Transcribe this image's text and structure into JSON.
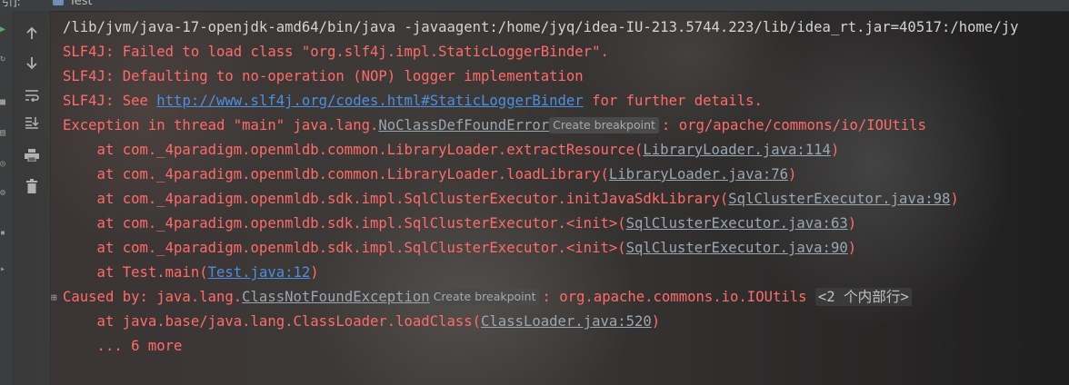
{
  "topbar": {
    "clipped_label": "引]:",
    "tab_label": "Test"
  },
  "toolbar": {
    "up": "↑",
    "down": "↓",
    "wrap": "⤶",
    "scroll_end": "⇊",
    "print": "🖶",
    "trash": "🗑"
  },
  "console": {
    "cmd": "/lib/jvm/java-17-openjdk-amd64/bin/java -javaagent:/home/jyq/idea-IU-213.5744.223/lib/idea_rt.jar=40517:/home/jy",
    "slf1": "SLF4J: Failed to load class \"org.slf4j.impl.StaticLoggerBinder\".",
    "slf2": "SLF4J: Defaulting to no-operation (NOP) logger implementation",
    "slf3_pre": "SLF4J: See ",
    "slf3_url": "http://www.slf4j.org/codes.html#StaticLoggerBinder",
    "slf3_post": " for further details.",
    "exc_pre": "Exception in thread \"main\" java.lang.",
    "exc_class": "NoClassDefFoundError",
    "exc_hint": "Create breakpoint",
    "exc_post": ": org/apache/commons/io/IOUtils",
    "frames": [
      {
        "pre": "    at com._4paradigm.openmldb.common.LibraryLoader.extractResource(",
        "link": "LibraryLoader.java:114",
        "post": ")"
      },
      {
        "pre": "    at com._4paradigm.openmldb.common.LibraryLoader.loadLibrary(",
        "link": "LibraryLoader.java:76",
        "post": ")"
      },
      {
        "pre": "    at com._4paradigm.openmldb.sdk.impl.SqlClusterExecutor.initJavaSdkLibrary(",
        "link": "SqlClusterExecutor.java:98",
        "post": ")"
      },
      {
        "pre": "    at com._4paradigm.openmldb.sdk.impl.SqlClusterExecutor.<init>(",
        "link": "SqlClusterExecutor.java:63",
        "post": ")"
      },
      {
        "pre": "    at com._4paradigm.openmldb.sdk.impl.SqlClusterExecutor.<init>(",
        "link": "SqlClusterExecutor.java:90",
        "post": ")"
      },
      {
        "pre": "    at Test.main(",
        "link": "Test.java:12",
        "post": ")"
      }
    ],
    "caused_pre": "Caused by: java.lang.",
    "caused_class": "ClassNotFoundException",
    "caused_hint": "Create breakpoint",
    "caused_post": ": org.apache.commons.io.IOUtils ",
    "caused_internal": "<2 个内部行>",
    "caused_frame": {
      "pre": "    at java.base/java.lang.ClassLoader.loadClass(",
      "link": "ClassLoader.java:520",
      "post": ")"
    },
    "more": "    ... 6 more"
  },
  "colors": {
    "error_text": "#ff6b68",
    "command_text": "#d3d3d3",
    "url": "#4c8fdf",
    "file_link": "#9aa7b0",
    "hint_bg": "#4a4a4a"
  }
}
